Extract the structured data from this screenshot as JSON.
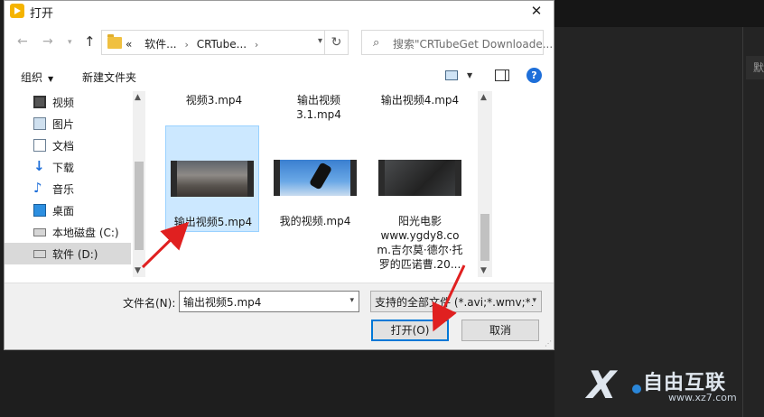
{
  "window": {
    "title": "打开"
  },
  "address": {
    "prefix": "«",
    "crumbs": [
      "软件...",
      "CRTube..."
    ],
    "search_placeholder": "搜索\"CRTubeGet Downloade..."
  },
  "toolbar": {
    "organize": "组织",
    "new_folder": "新建文件夹"
  },
  "nav": {
    "items": [
      {
        "label": "视频",
        "icon": "video-icon"
      },
      {
        "label": "图片",
        "icon": "picture-icon"
      },
      {
        "label": "文档",
        "icon": "document-icon"
      },
      {
        "label": "下载",
        "icon": "download-icon"
      },
      {
        "label": "音乐",
        "icon": "music-icon"
      },
      {
        "label": "桌面",
        "icon": "desktop-icon"
      },
      {
        "label": "本地磁盘 (C:)",
        "icon": "drive-icon"
      },
      {
        "label": "软件 (D:)",
        "icon": "drive-icon"
      }
    ]
  },
  "files": {
    "top_row": [
      "视频3.mp4",
      "输出视频\n3.1.mp4",
      "输出视频4.mp4"
    ],
    "items": [
      {
        "name": "输出视频5.mp4",
        "selected": true
      },
      {
        "name": "我的视频.mp4",
        "selected": false
      },
      {
        "name": "阳光电影\nwww.ygdy8.co\nm.吉尔莫·德尔·托\n罗的匹诺曹.20...",
        "selected": false
      }
    ]
  },
  "bottom": {
    "filename_label": "文件名(N):",
    "filename_value": "输出视频5.mp4",
    "filter_value": "支持的全部文件 (*.avi;*.wmv;*.",
    "open_button": "打开(O)",
    "cancel_button": "取消"
  },
  "background": {
    "tab_label": "默"
  },
  "watermark": {
    "brand": "自由互联",
    "url": "www.xz7.com"
  },
  "colors": {
    "selection": "#cce8ff",
    "accent": "#0078d7",
    "annotation": "#e02020"
  }
}
